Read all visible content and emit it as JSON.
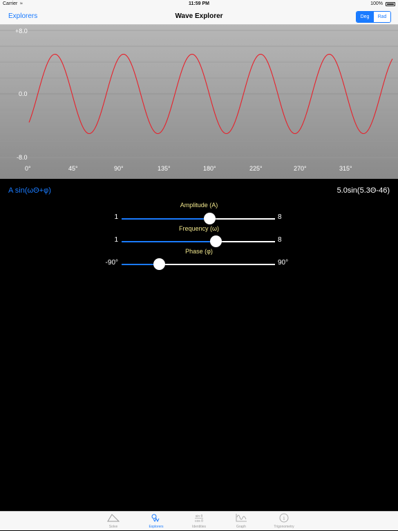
{
  "status": {
    "carrier": "Carrier",
    "time": "11:59 PM",
    "battery": "100%"
  },
  "nav": {
    "back_label": "Explorers",
    "title": "Wave Explorer",
    "deg_label": "Deg",
    "rad_label": "Rad"
  },
  "colors": {
    "accent": "#1a7bff",
    "wave": "#e8202a",
    "slider_title": "#f0e68c"
  },
  "chart_data": {
    "type": "line",
    "title": "",
    "xlabel": "",
    "ylabel": "",
    "ylim": [
      -8,
      8
    ],
    "xlim": [
      0,
      360
    ],
    "y_tick_labels": [
      "+8.0",
      "0.0",
      "-8.0"
    ],
    "x_tick_labels": [
      "0°",
      "45°",
      "90°",
      "135°",
      "180°",
      "225°",
      "270°",
      "315°"
    ],
    "grid": true,
    "series": [
      {
        "function": "5.0sin(5.3Θ-46)",
        "amplitude": 5.0,
        "frequency": 5.3,
        "phase_deg": -46
      }
    ]
  },
  "panel": {
    "formula": "A sin(ωΘ+φ)",
    "equation": "5.0sin(5.3Θ-46)",
    "sliders": [
      {
        "title": "Amplitude (A)",
        "min_label": "1",
        "max_label": "8",
        "min": 1,
        "max": 8,
        "value": 5.0
      },
      {
        "title": "Frequency (ω)",
        "min_label": "1",
        "max_label": "8",
        "min": 1,
        "max": 8,
        "value": 5.3
      },
      {
        "title": "Phase (φ)",
        "min_label": "-90°",
        "max_label": "90°",
        "min": -90,
        "max": 90,
        "value": -46
      }
    ]
  },
  "tabs": [
    {
      "label": "Solve",
      "icon": "triangle-icon",
      "active": false
    },
    {
      "label": "Explorers",
      "icon": "wave-explorer-icon",
      "active": true
    },
    {
      "label": "Identities",
      "icon": "identity-icon",
      "active": false
    },
    {
      "label": "Graph",
      "icon": "graph-icon",
      "active": false
    },
    {
      "label": "Trigonometry",
      "icon": "info-icon",
      "active": false
    }
  ]
}
